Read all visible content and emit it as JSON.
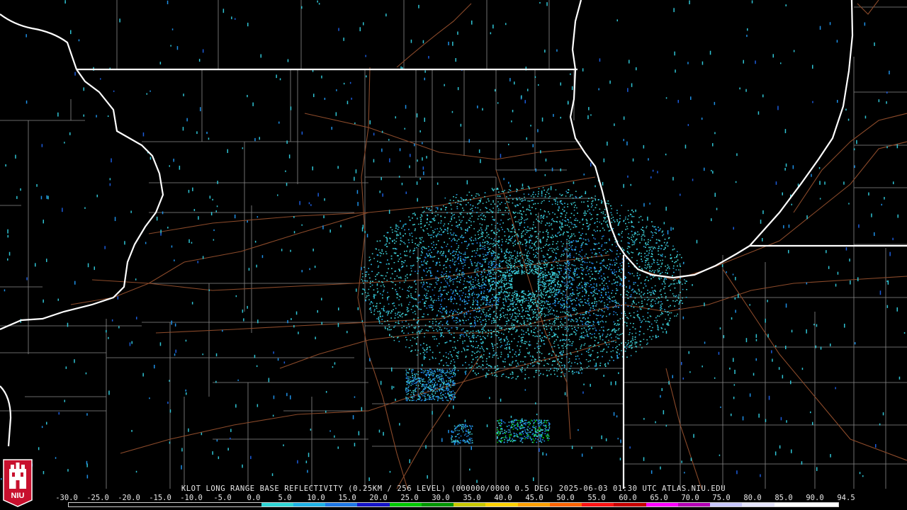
{
  "map": {
    "caption": "KLOT LONG RANGE BASE REFLECTIVITY (0.25KM / 256 LEVEL) (000000/0000 0.5 DEG) 2025-06-03 01:30 UTC  ATLAS.NIU.EDU",
    "logo_text": "NIU",
    "colors": {
      "background": "#000000",
      "state_borders": "#ffffff",
      "county_borders": "#8a8a8a",
      "highways": "#8b4a2a"
    },
    "scale": {
      "labels": [
        "-30.0",
        "-25.0",
        "-20.0",
        "-15.0",
        "-10.0",
        "-5.0",
        "0.0",
        "5.0",
        "10.0",
        "15.0",
        "20.0",
        "25.0",
        "30.0",
        "35.0",
        "40.0",
        "45.0",
        "50.0",
        "55.0",
        "60.0",
        "65.0",
        "70.0",
        "75.0",
        "80.0",
        "85.0",
        "90.0",
        "94.5"
      ],
      "colors": [
        "#000000",
        "#000000",
        "#000000",
        "#000000",
        "#000000",
        "#000000",
        "#2fd6d6",
        "#1fb2e6",
        "#1e78e6",
        "#1414c8",
        "#00c800",
        "#009600",
        "#c8c800",
        "#ffd200",
        "#ffa000",
        "#ff6400",
        "#ff1414",
        "#c80000",
        "#ff00ff",
        "#b400b4",
        "#c8c8ff",
        "#e6e6ff",
        "#ffffff",
        "#ffffff"
      ]
    }
  }
}
